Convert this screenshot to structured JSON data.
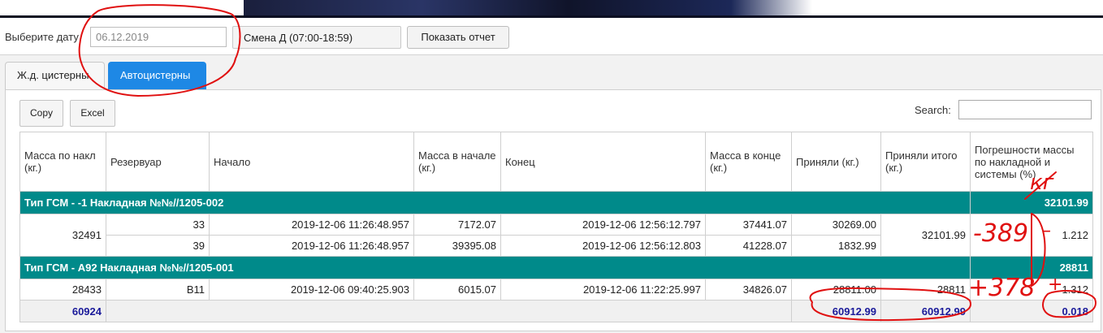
{
  "filter": {
    "date_label": "Выберите дату",
    "date_value": "06.12.2019",
    "shift": "Смена Д (07:00-18:59)",
    "show_report": "Показать отчет"
  },
  "tabs": [
    {
      "label": "Ж.д. цистерны",
      "active": false
    },
    {
      "label": "Автоцистерны",
      "active": true
    }
  ],
  "toolbar": {
    "copy": "Copy",
    "excel": "Excel",
    "search_label": "Search:"
  },
  "table": {
    "headers": [
      "Масса по накл (кг.)",
      "Резервуар",
      "Начало",
      "Масса в начале (кг.)",
      "Конец",
      "Масса в конце (кг.)",
      "Приняли (кг.)",
      "Приняли итого (кг.)",
      "Погрешности массы по накладной и системы (%)"
    ],
    "groups": [
      {
        "title": "Тип ГСМ - -1 Накладная №№//1205-002",
        "total": "32101.99",
        "mass_nakl": "32491",
        "received_total": "32101.99",
        "error": "1.212",
        "rows": [
          {
            "reservoir": "33",
            "start": "2019-12-06 11:26:48.957",
            "mass_start": "7172.07",
            "end": "2019-12-06 12:56:12.797",
            "mass_end": "37441.07",
            "received": "30269.00"
          },
          {
            "reservoir": "39",
            "start": "2019-12-06 11:26:48.957",
            "mass_start": "39395.08",
            "end": "2019-12-06 12:56:12.803",
            "mass_end": "41228.07",
            "received": "1832.99"
          }
        ]
      },
      {
        "title": "Тип ГСМ - А92 Накладная №№//1205-001",
        "total": "28811",
        "mass_nakl": "28433",
        "received_total": "28811",
        "error": "1.312",
        "rows": [
          {
            "reservoir": "В11",
            "start": "2019-12-06 09:40:25.903",
            "mass_start": "6015.07",
            "end": "2019-12-06 11:22:25.997",
            "mass_end": "34826.07",
            "received": "28811.00"
          }
        ]
      }
    ],
    "footer": {
      "mass_nakl": "60924",
      "received": "60912.99",
      "received_total": "60912.99",
      "error": "0.018"
    }
  },
  "annotations": {
    "unit": "кг",
    "diff1": "-389",
    "diff2": "+378",
    "color": "#e01010"
  }
}
